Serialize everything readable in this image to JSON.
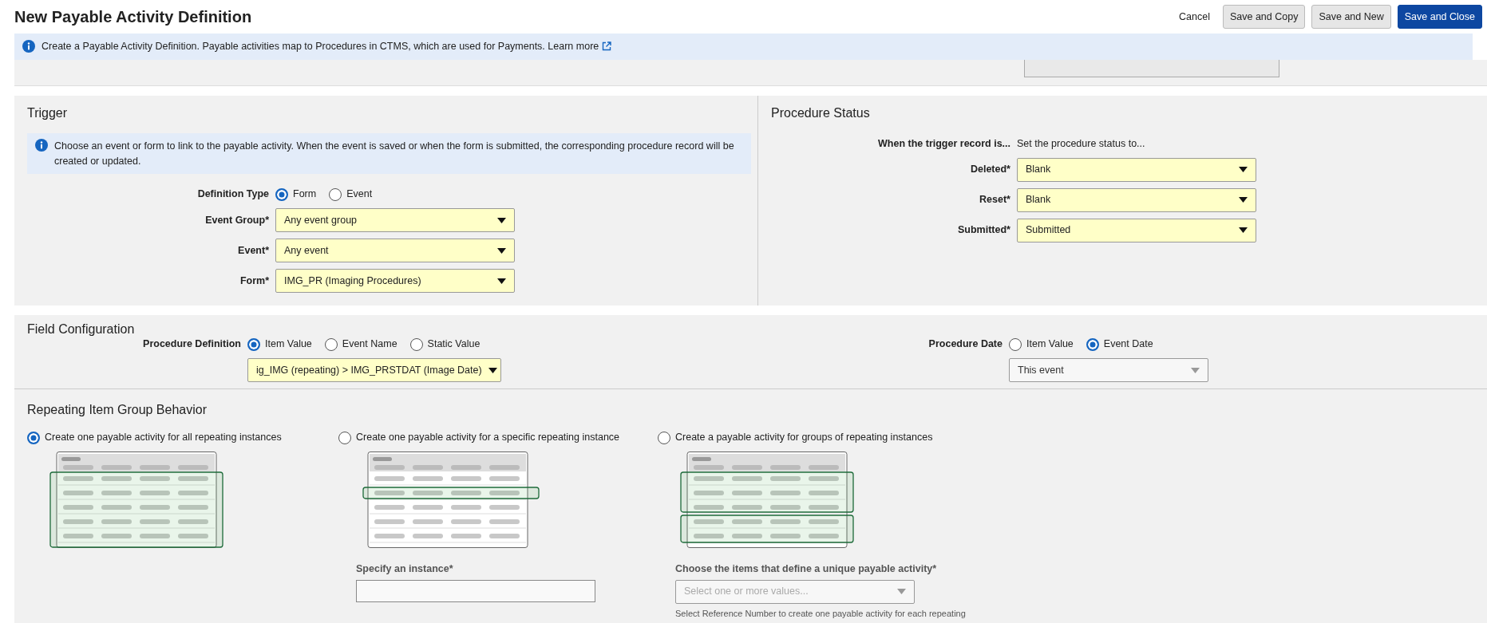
{
  "header": {
    "title": "New Payable Activity Definition",
    "buttons": [
      {
        "label": "Cancel",
        "kind": "link"
      },
      {
        "label": "Save and Copy",
        "kind": "secondary"
      },
      {
        "label": "Save and New",
        "kind": "secondary"
      },
      {
        "label": "Save and Close",
        "kind": "primary"
      }
    ]
  },
  "info_banner": {
    "text": "Create a Payable Activity Definition. Payable activities map to Procedures in CTMS, which are used for Payments.",
    "link": "Learn more"
  },
  "trigger": {
    "title": "Trigger",
    "info": "Choose an event or form to link to the payable activity. When the event is saved or when the form is submitted, the corresponding procedure record will be created or updated.",
    "definition_type": {
      "label": "Definition Type",
      "options": [
        {
          "label": "Form",
          "selected": true
        },
        {
          "label": "Event",
          "selected": false
        }
      ]
    },
    "fields": [
      {
        "label": "Event Group*",
        "value": "Any event group"
      },
      {
        "label": "Event*",
        "value": "Any event"
      },
      {
        "label": "Form*",
        "value": "IMG_PR (Imaging Procedures)"
      }
    ]
  },
  "procedure_status": {
    "title": "Procedure Status",
    "header_label": "When the trigger record is...",
    "header_value": "Set the procedure status to...",
    "fields": [
      {
        "label": "Deleted*",
        "value": "Blank"
      },
      {
        "label": "Reset*",
        "value": "Blank"
      },
      {
        "label": "Submitted*",
        "value": "Submitted"
      }
    ]
  },
  "field_configuration": {
    "title": "Field Configuration",
    "procedure_definition": {
      "label": "Procedure Definition",
      "options": [
        {
          "label": "Item Value",
          "selected": true
        },
        {
          "label": "Event Name",
          "selected": false
        },
        {
          "label": "Static Value",
          "selected": false
        }
      ],
      "value": "ig_IMG (repeating) > IMG_PRSTDAT (Image Date)",
      "disabled": false
    },
    "procedure_date": {
      "label": "Procedure Date",
      "options": [
        {
          "label": "Item Value",
          "selected": false
        },
        {
          "label": "Event Date",
          "selected": true
        }
      ],
      "value": "This event",
      "disabled": true
    }
  },
  "repeating": {
    "title": "Repeating Item Group Behavior",
    "options": [
      {
        "label": "Create one payable activity for all repeating instances",
        "selected": true,
        "kind": "all"
      },
      {
        "label": "Create one payable activity for a specific repeating instance",
        "selected": false,
        "kind": "specific",
        "field_label": "Specify an instance*"
      },
      {
        "label": "Create a payable activity for groups of repeating instances",
        "selected": false,
        "kind": "groups",
        "field_label": "Choose the items that define a unique payable activity*",
        "placeholder": "Select one or more values...",
        "help": "Select Reference Number to create one payable activity for each repeating"
      }
    ]
  }
}
